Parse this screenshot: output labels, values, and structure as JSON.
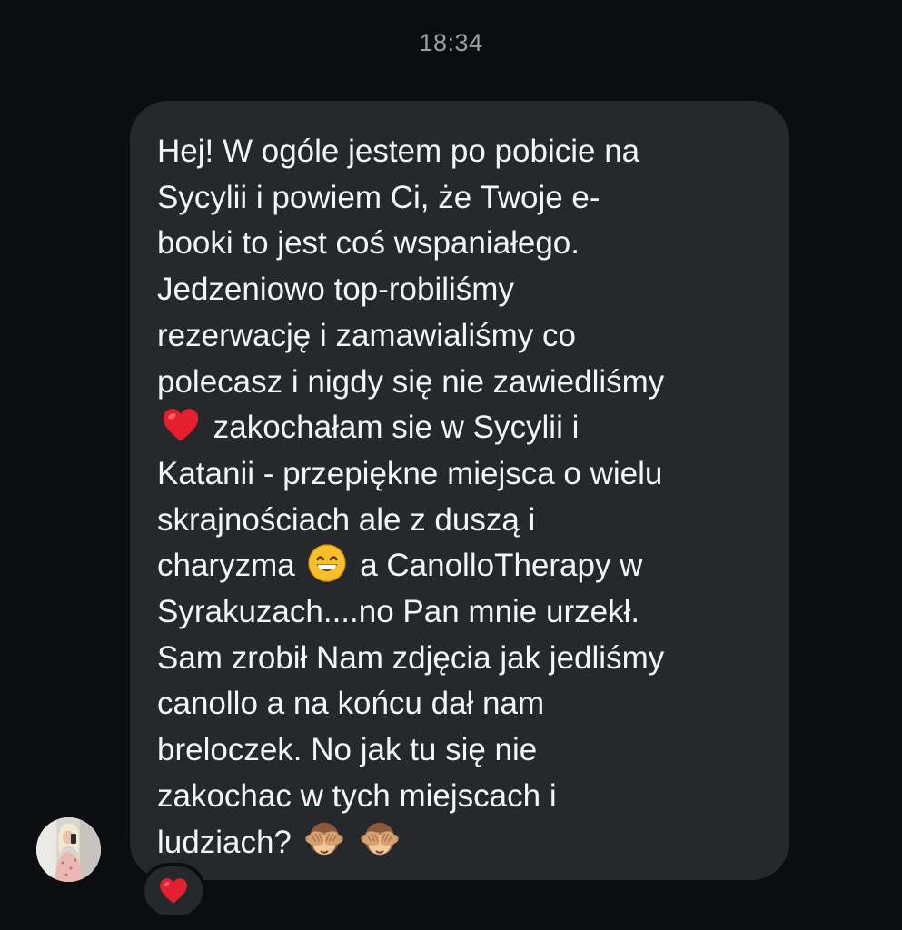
{
  "header": {
    "timestamp": "18:34"
  },
  "message": {
    "lines": [
      "Hej! W ogóle jestem po pobicie na",
      "Sycylii i powiem Ci, że Twoje e-",
      "booki to jest coś wspaniałego.",
      "Jedzeniowo top-robiliśmy",
      "rezerwację i zamawialiśmy co",
      "polecasz i nigdy się nie zawiedliśmy",
      "zakochałam sie w Sycylii i",
      "Katanii - przepiękne miejsca o wielu",
      "skrajnościach ale z duszą i",
      "charyzma",
      "a CanolloTherapy w",
      "Syrakuzach....no Pan mnie urzekł.",
      "Sam zrobił Nam zdjęcia jak jedliśmy",
      "canollo a na końcu dał nam",
      "breloczek. No jak tu się nie",
      "zakochac w tych miejscach i",
      "ludziach?"
    ],
    "emojis": [
      "red-heart",
      "grinning-face-with-smiling-eyes",
      "see-no-evil-monkey"
    ]
  },
  "reaction": {
    "emoji": "red-heart"
  },
  "colors": {
    "background": "#0b0d11",
    "bubble": "#26282c",
    "text": "#f4f5f7",
    "timestamp": "#9a9da3",
    "heart": "#e5202e"
  }
}
